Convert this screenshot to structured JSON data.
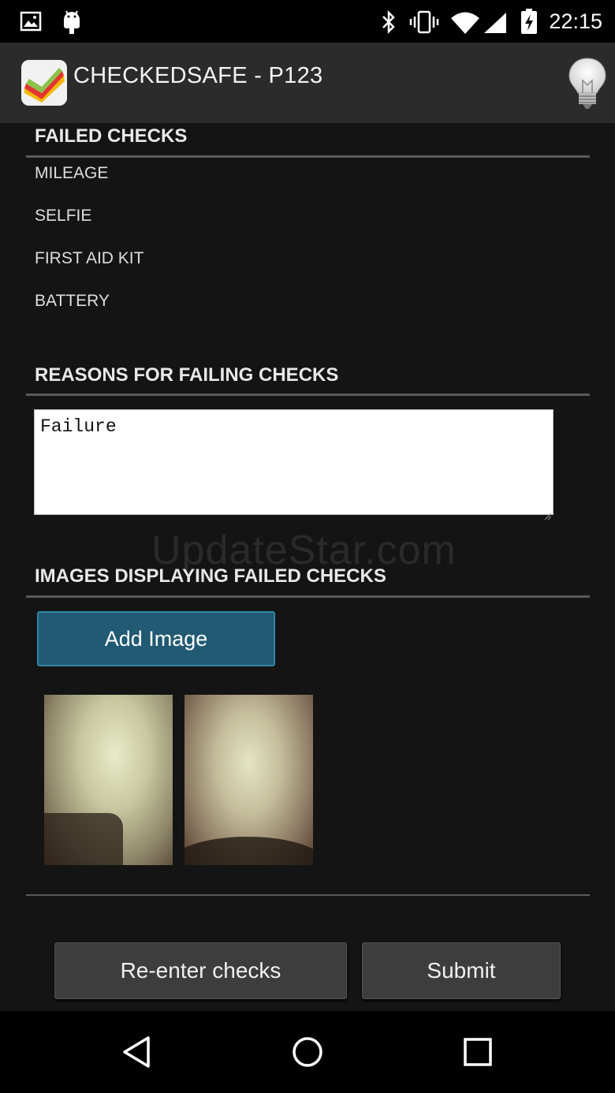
{
  "status_bar": {
    "time": "22:15",
    "left_icons": [
      "image-icon",
      "android-icon"
    ],
    "right_icons": [
      "bluetooth-icon",
      "vibrate-icon",
      "wifi-icon",
      "signal-icon",
      "battery-charging-icon"
    ]
  },
  "action_bar": {
    "title": "CHECKEDSAFE - P123",
    "app_icon": "checkedsafe-logo-icon",
    "action_icon": "lightbulb-icon"
  },
  "failed_checks": {
    "header": "FAILED CHECKS",
    "items": [
      "MILEAGE",
      "SELFIE",
      "FIRST AID KIT",
      "BATTERY"
    ]
  },
  "reasons": {
    "header": "REASONS FOR FAILING CHECKS",
    "value": "Failure"
  },
  "images": {
    "header": "IMAGES DISPLAYING FAILED CHECKS",
    "add_button": "Add Image",
    "thumbnails": 2
  },
  "watermark": "UpdateStar.com",
  "buttons": {
    "reenter": "Re-enter checks",
    "submit": "Submit"
  },
  "nav_bar": [
    "back-icon",
    "home-icon",
    "recents-icon"
  ],
  "colors": {
    "background": "#141414",
    "action_bar": "#2b2b2b",
    "accent_button": "#215a72"
  }
}
